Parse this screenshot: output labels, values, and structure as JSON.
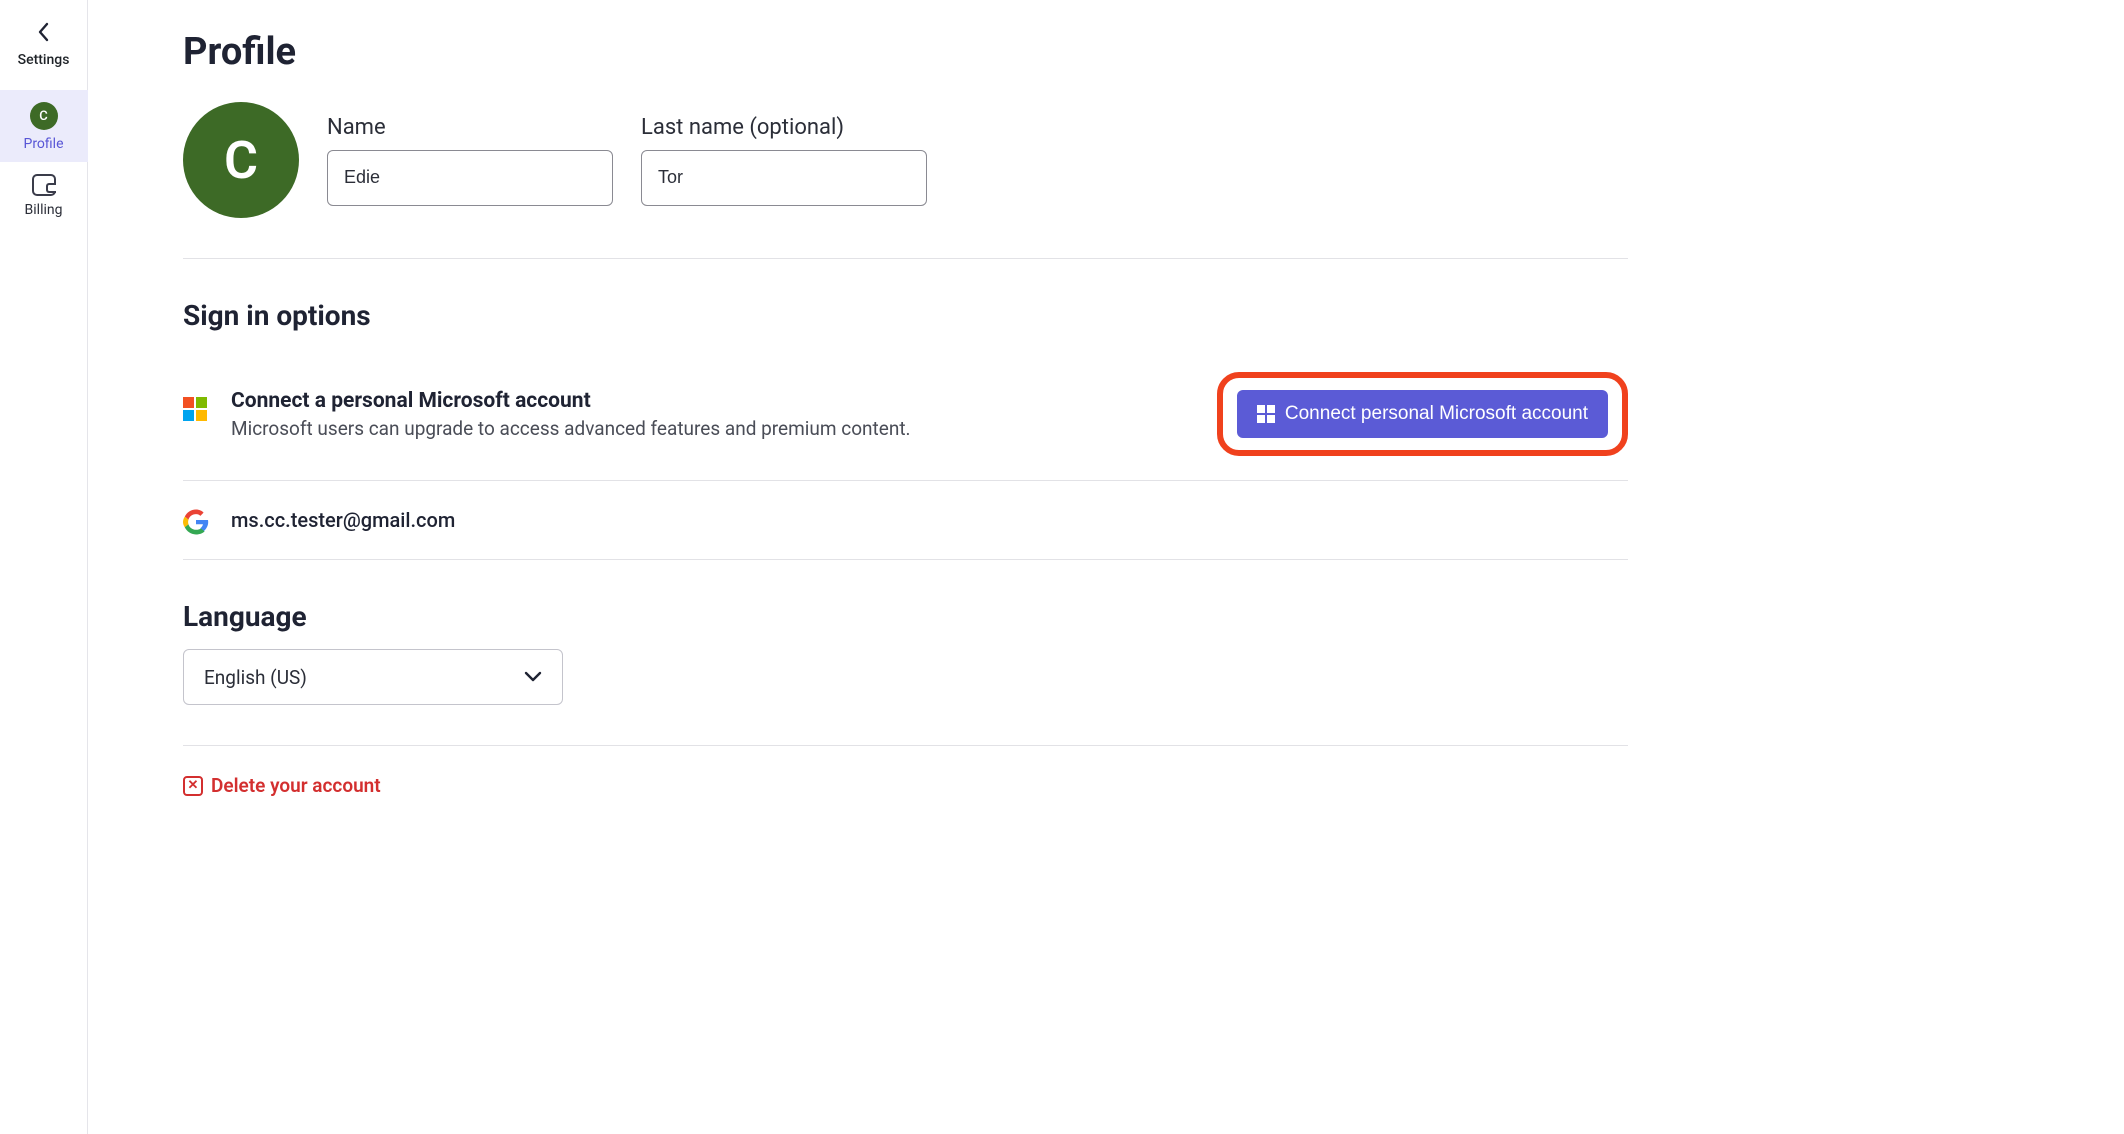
{
  "sidebar": {
    "header_label": "Settings",
    "items": [
      {
        "label": "Profile",
        "avatar_letter": "C"
      },
      {
        "label": "Billing"
      }
    ]
  },
  "page": {
    "title": "Profile",
    "avatar_letter": "C"
  },
  "name_field": {
    "label": "Name",
    "value": "Edie"
  },
  "lastname_field": {
    "label": "Last name (optional)",
    "value": "Tor"
  },
  "signin": {
    "section_title": "Sign in options",
    "ms": {
      "title": "Connect a personal Microsoft account",
      "desc": "Microsoft users can upgrade to access advanced features and premium content.",
      "button_label": "Connect personal Microsoft account"
    },
    "google": {
      "email": "ms.cc.tester@gmail.com"
    }
  },
  "language": {
    "section_title": "Language",
    "selected": "English (US)"
  },
  "delete": {
    "label": "Delete your account"
  }
}
